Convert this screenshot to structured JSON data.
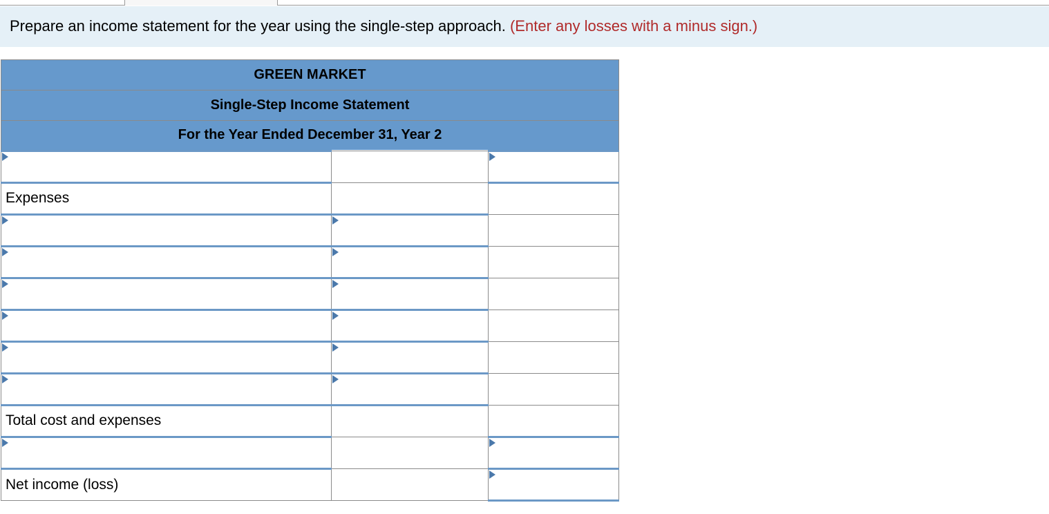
{
  "instruction": {
    "main": "Prepare an income statement for the year using the single-step approach. ",
    "note": "(Enter any losses with a minus sign.)"
  },
  "statement": {
    "company": "GREEN MARKET",
    "title": "Single-Step Income Statement",
    "period": "For the Year Ended December 31, Year 2",
    "rows": {
      "expenses_label": "Expenses",
      "total_cost_label": "Total cost and expenses",
      "net_income_label": "Net income (loss)"
    }
  }
}
